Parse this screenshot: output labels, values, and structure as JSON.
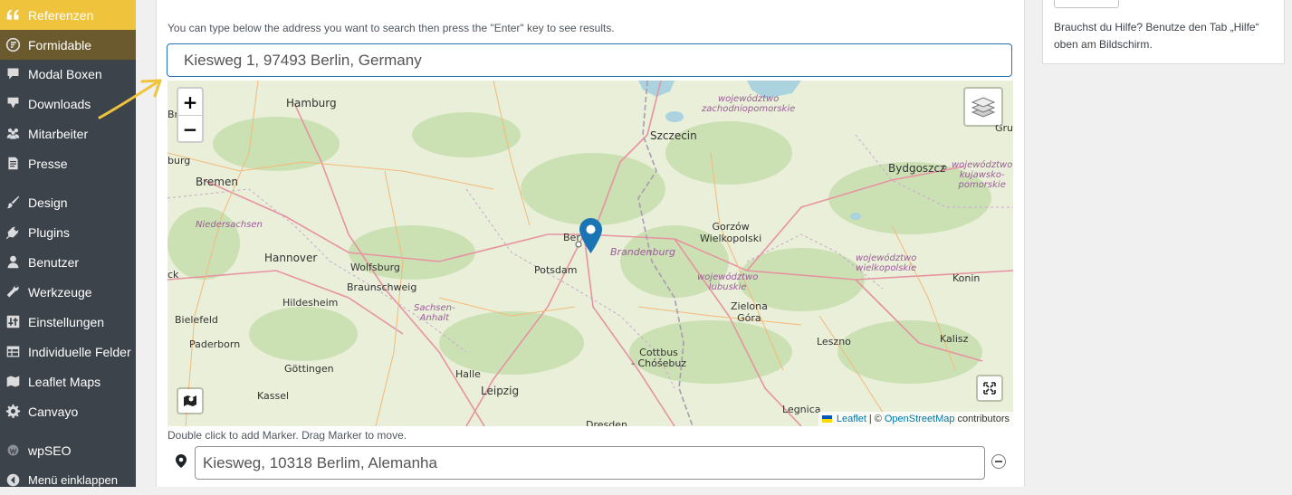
{
  "sidebar": {
    "items": [
      {
        "label": "Referenzen",
        "icon": "quote-icon"
      },
      {
        "label": "Formidable",
        "icon": "formidable-icon"
      },
      {
        "label": "Modal Boxen",
        "icon": "comment-icon"
      },
      {
        "label": "Downloads",
        "icon": "download-icon"
      },
      {
        "label": "Mitarbeiter",
        "icon": "groups-icon"
      },
      {
        "label": "Presse",
        "icon": "document-icon"
      },
      {
        "label": "Design",
        "icon": "paintbrush-icon"
      },
      {
        "label": "Plugins",
        "icon": "plugin-icon"
      },
      {
        "label": "Benutzer",
        "icon": "user-icon"
      },
      {
        "label": "Werkzeuge",
        "icon": "wrench-icon"
      },
      {
        "label": "Einstellungen",
        "icon": "settings-icon"
      },
      {
        "label": "Individuelle Felder",
        "icon": "table-icon"
      },
      {
        "label": "Leaflet Maps",
        "icon": "map-icon"
      },
      {
        "label": "Canvayo",
        "icon": "gear-icon"
      },
      {
        "label": "wpSEO",
        "icon": "wpseo-icon"
      },
      {
        "label": "Menü einklappen",
        "icon": "collapse-icon"
      }
    ]
  },
  "main": {
    "hint": "You can type below the address you want to search then press the \"Enter\" key to see results.",
    "search_value": "Kiesweg 1, 97493 Berlin, Germany",
    "double_click_hint": "Double click to add Marker. Drag Marker to move.",
    "marker_address": "Kiesweg, 10318 Berlim, Alemanha"
  },
  "map": {
    "zoom_in": "+",
    "zoom_out": "−",
    "cities": [
      "Hamburg",
      "Szczecin",
      "Bydgoszcz",
      "Bremen",
      "Hannover",
      "Wolfsburg",
      "Braunschweig",
      "Hildesheim",
      "Bielefeld",
      "Paderborn",
      "Göttingen",
      "Kassel",
      "Halle",
      "Leipzig",
      "Potsdam",
      "Ber",
      "Gorzów Wielkopolski",
      "Zielona Góra",
      "Cottbus - Chóśebuz",
      "Leszno",
      "Konin",
      "Kalisz",
      "Legnica",
      "Dresden",
      "Grudzia",
      "burg",
      "ck",
      "Bre"
    ],
    "regions": [
      "województwo zachodniopomorskie",
      "województwo kujawsko-pomorskie",
      "Niedersachsen",
      "Brandenburg",
      "województwo lubuskie",
      "województwo wielkopolskie",
      "Sachsen-Anhalt"
    ],
    "attribution": {
      "leaflet": "Leaflet",
      "separator": "|",
      "copyright": "©",
      "osm": "OpenStreetMap",
      "suffix": "contributors"
    }
  },
  "help": {
    "text": "Brauchst du Hilfe? Benutze den Tab „Hilfe“ oben am Bildschirm."
  },
  "colors": {
    "sidebar_bg": "#3c434a",
    "active_bg": "#f0c33c",
    "accent_blue": "#2271b1",
    "marker_blue": "#1b75b4",
    "arrow": "#f0c33c"
  }
}
